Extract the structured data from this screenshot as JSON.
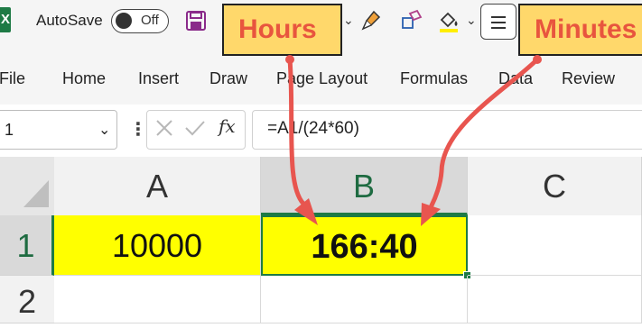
{
  "title_bar": {
    "autosave_label": "AutoSave",
    "autosave_state": "Off"
  },
  "annotations": {
    "hours_label": "Hours",
    "minutes_label": "Minutes"
  },
  "ribbon": {
    "tabs": [
      "File",
      "Home",
      "Insert",
      "Draw",
      "Page Layout",
      "Formulas",
      "Data",
      "Review"
    ]
  },
  "formula_bar": {
    "name_box": "1",
    "fx_label": "fx",
    "formula": "=A1/(24*60)"
  },
  "grid": {
    "columns": [
      "A",
      "B",
      "C"
    ],
    "rows": [
      "1",
      "2"
    ],
    "cells": {
      "A1": "10000",
      "B1": "166:40"
    }
  },
  "colors": {
    "accent": "#1e7a45",
    "cell_fill": "#ffff00",
    "callout_fill": "#ffd86b",
    "callout_text": "#e8553e",
    "arrow": "#e8554f"
  }
}
